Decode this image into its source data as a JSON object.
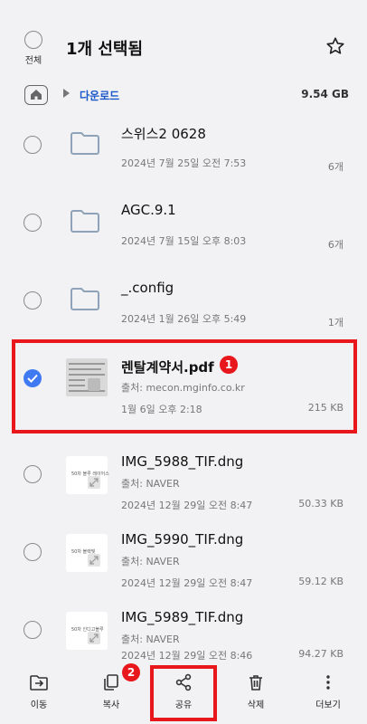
{
  "header": {
    "select_all_label": "전체",
    "title": "1개 선택됨"
  },
  "breadcrumb": {
    "folder": "다운로드",
    "storage": "9.54 GB"
  },
  "files": [
    {
      "name": "스위스2 0628",
      "date": "2024년 7월 25일 오전 7:53",
      "meta": "6개",
      "type": "folder"
    },
    {
      "name": "AGC.9.1",
      "date": "2024년 7월 15일 오후 8:03",
      "meta": "6개",
      "type": "folder"
    },
    {
      "name": "_.config",
      "date": "2024년 1월 26일 오후 5:49",
      "meta": "1개",
      "type": "folder"
    },
    {
      "name": "렌탈계약서.pdf",
      "source": "출처: mecon.mginfo.co.kr",
      "date": "1월 6일 오후 2:18",
      "meta": "215 KB",
      "type": "pdf",
      "selected": true
    },
    {
      "name": "IMG_5988_TIF.dng",
      "source": "출처: NAVER",
      "date": "2024년 12월 29일 오전 8:47",
      "meta": "50.33 KB",
      "type": "image",
      "thumb_text": "50차 블루 레이어스"
    },
    {
      "name": "IMG_5990_TIF.dng",
      "source": "출처: NAVER",
      "date": "2024년 12월 29일 오전 8:47",
      "meta": "59.12 KB",
      "type": "image",
      "thumb_text": "50차 블랙빛"
    },
    {
      "name": "IMG_5989_TIF.dng",
      "source": "출처: NAVER",
      "date": "2024년 12월 29일 오전 8:46",
      "meta": "94.27 KB",
      "type": "image",
      "thumb_text": "50차 인디고블루"
    }
  ],
  "badges": {
    "one": "1",
    "two": "2"
  },
  "toolbar": {
    "move": "이동",
    "copy": "복사",
    "share": "공유",
    "delete": "삭제",
    "more": "더보기"
  },
  "colors": {
    "accent": "#3f7af2",
    "annotation": "#e8171b",
    "link": "#1a57c9"
  }
}
